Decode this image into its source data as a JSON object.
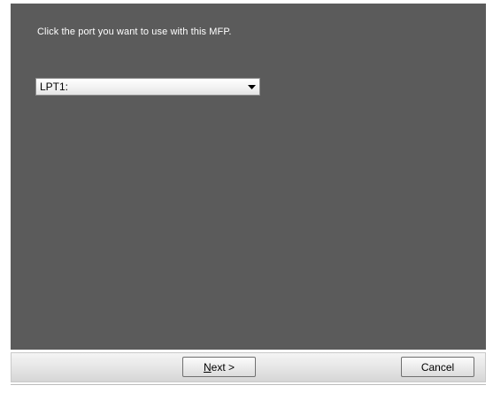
{
  "instruction": "Click the port you want to use with this MFP.",
  "port_select": {
    "selected": "LPT1:"
  },
  "buttons": {
    "next_mnemonic": "N",
    "next_rest": "ext >",
    "cancel": "Cancel"
  },
  "colors": {
    "content_background": "#5b5b5b",
    "instruction_text": "#ffffff",
    "footer_background": "#e6e6e6"
  },
  "icons": {
    "dropdown": "chevron-down-icon"
  }
}
